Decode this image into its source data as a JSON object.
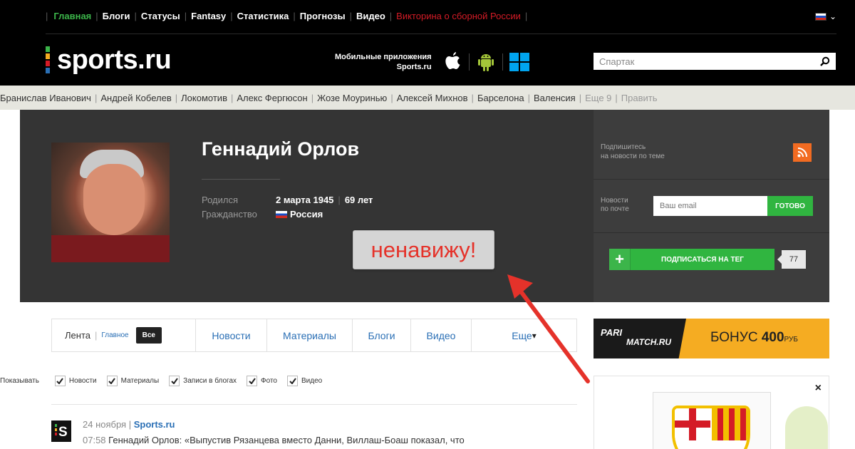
{
  "topnav": {
    "items": [
      {
        "label": "Главная",
        "style": "active"
      },
      {
        "label": "Блоги",
        "style": ""
      },
      {
        "label": "Статусы",
        "style": ""
      },
      {
        "label": "Fantasy",
        "style": ""
      },
      {
        "label": "Статистика",
        "style": ""
      },
      {
        "label": "Прогнозы",
        "style": ""
      },
      {
        "label": "Видео",
        "style": ""
      },
      {
        "label": "Викторина о сборной России",
        "style": "promo"
      }
    ]
  },
  "logo": {
    "text": "sports.ru",
    "dot_colors": [
      "#3cb54a",
      "#f5ac22",
      "#d41b26",
      "#2a6fb5"
    ]
  },
  "apps": {
    "line1": "Мобильные приложения",
    "line2": "Sports.ru",
    "icons": [
      "apple-icon",
      "android-icon",
      "windows-icon"
    ]
  },
  "search": {
    "value": "Спартак"
  },
  "tags": {
    "items": [
      "Бранислав Иванович",
      "Андрей Кобелев",
      "Локомотив",
      "Алекс Фергюсон",
      "Жозе Моуринью",
      "Алексей Михнов",
      "Барселона",
      "Валенсия"
    ],
    "more": "Еще 9",
    "edit": "Править"
  },
  "person": {
    "name": "Геннадий Орлов",
    "born_label": "Родился",
    "born_value": "2 марта 1945",
    "age": "69 лет",
    "citizenship_label": "Гражданство",
    "citizenship_value": "Россия"
  },
  "annotation": {
    "text": "ненавижу!"
  },
  "subscribe": {
    "news_line1": "Подпишитесь",
    "news_line2": "на новости по теме",
    "mail_line1": "Новости",
    "mail_line2": "по почте",
    "email_placeholder": "Ваш email",
    "email_button": "ГОТОВО",
    "follow_button": "ПОДПИСАТЬСЯ НА ТЕГ",
    "follow_count": "77"
  },
  "feed": {
    "first_tab": "Лента",
    "main_link": "Главное",
    "all_label": "Все",
    "tabs": [
      "Новости",
      "Материалы",
      "Блоги",
      "Видео",
      "Еще"
    ],
    "show_label": "Показывать",
    "filters": [
      "Новости",
      "Материалы",
      "Записи в блогах",
      "Фото",
      "Видео"
    ],
    "item": {
      "date": "24 ноября",
      "source": "Sports.ru",
      "time": "07:58",
      "text": "Геннадий Орлов: «Выпустив Рязанцева вместо Данни, Виллаш-Боаш показал, что"
    }
  },
  "ad": {
    "brand1": "PARI",
    "brand2": "MATCH.RU",
    "bonus_prefix": "БОНУС",
    "bonus_amount": "400",
    "bonus_suffix": "РУБ",
    "close": "×",
    "crest_label": "FCB"
  },
  "colors": {
    "accent_green": "#3cb54a",
    "link_blue": "#2a6fb5",
    "promo_red": "#d41b26",
    "rss_orange": "#f26b21",
    "ad_orange": "#f5ac22"
  }
}
